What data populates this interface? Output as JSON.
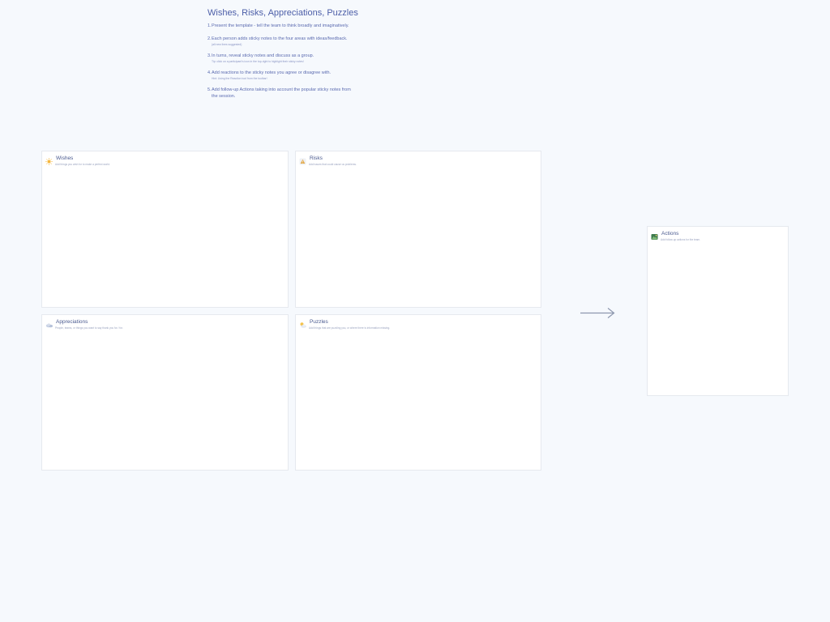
{
  "board": {
    "title": "Wishes, Risks, Appreciations, Puzzles",
    "steps": [
      {
        "num": "1.",
        "text": "Present the template - tell the team to think broadly and imaginatively.",
        "sub": ""
      },
      {
        "num": "2.",
        "text": "Each person adds sticky notes to the four areas with ideas/feedback.",
        "sub": "(all new lines suggested)"
      },
      {
        "num": "3.",
        "text": "In turns, reveal sticky notes and discuss as a group.",
        "sub": "Tip: click on a participant's icon in the top-right to highlight their sticky notes!"
      },
      {
        "num": "4.",
        "text": "Add reactions to the sticky notes you agree or disagree with.",
        "sub": "Hint: Using the Reaction tool from the toolbar!"
      },
      {
        "num": "5.",
        "text": "Add follow-up Actions taking into account the popular sticky notes from",
        "cont": "the session.",
        "sub": ""
      }
    ]
  },
  "frames": {
    "wishes": {
      "title": "Wishes",
      "subtitle": "Add things you wish for to make a perfect world.",
      "icon": "sun-icon"
    },
    "risks": {
      "title": "Risks",
      "subtitle": "Add issues that could cause us problems.",
      "icon": "warning-icon"
    },
    "appreciations": {
      "title": "Appreciations",
      "subtitle": "People, teams, or things you want to say thank you for / for.",
      "icon": "cloud-icon"
    },
    "puzzles": {
      "title": "Puzzles",
      "subtitle": "Add things that are puzzling you, or where there is information missing.",
      "icon": "partly-cloudy-icon"
    },
    "actions": {
      "title": "Actions",
      "subtitle": "Add follow-up actions for the team.",
      "icon": "landscape-icon"
    }
  },
  "colors": {
    "background": "#f6f9fd",
    "title": "#4c5ea8",
    "arrow": "#8d97ae"
  }
}
